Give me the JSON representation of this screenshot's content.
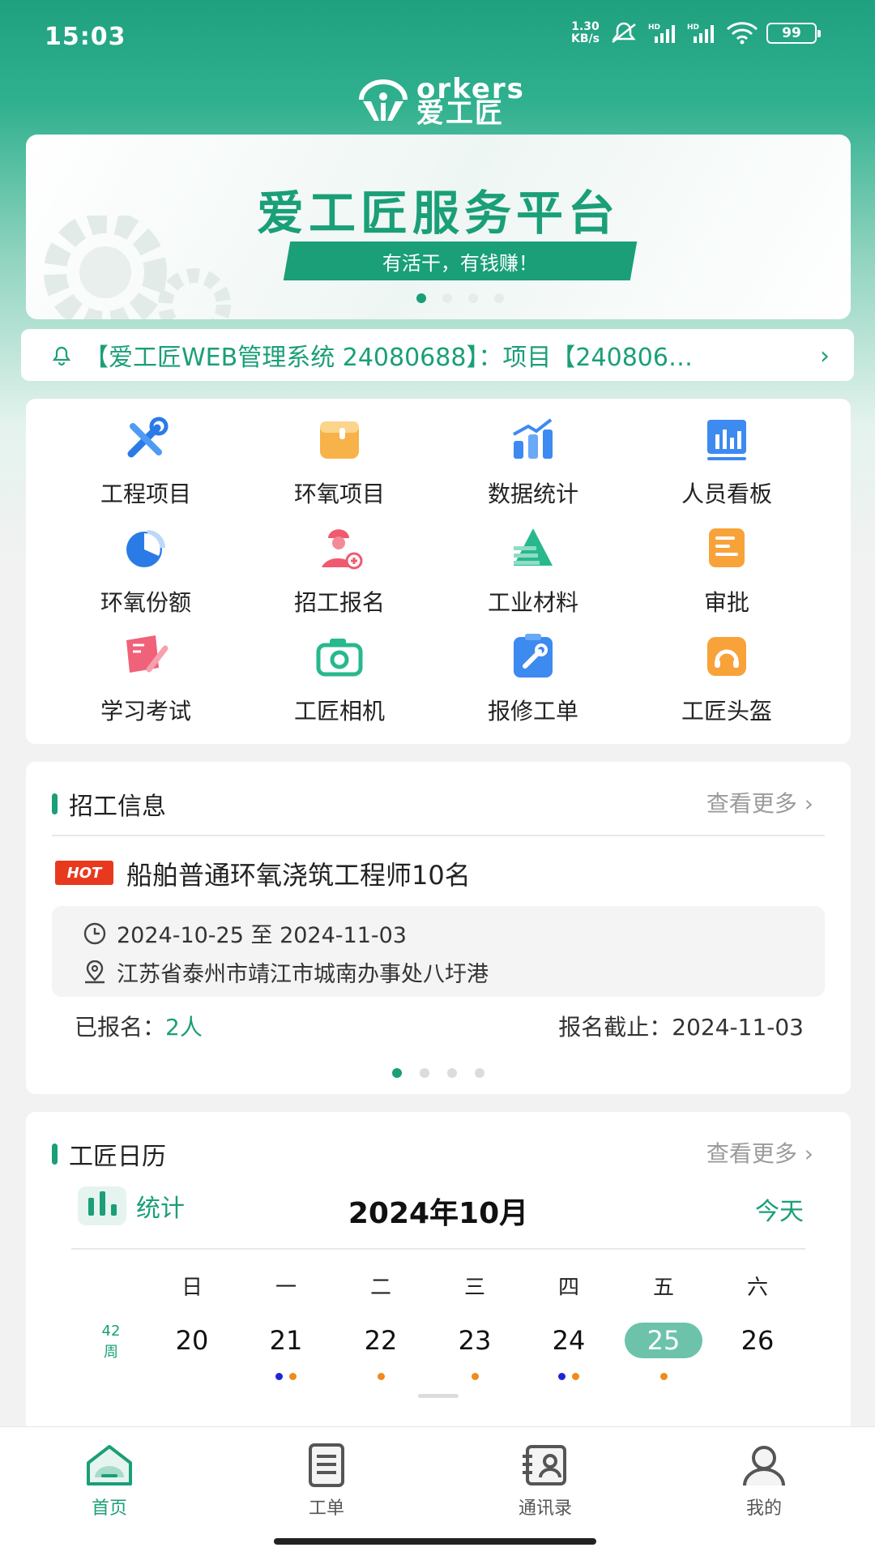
{
  "status_bar": {
    "time": "15:03",
    "net_speed": "1.30",
    "net_unit": "KB/s",
    "battery": "99"
  },
  "logo": {
    "brand_en": "orkers",
    "brand_cn": "爱工匠"
  },
  "banner": {
    "title": "爱工匠服务平台",
    "slogan": "有活干，有钱赚！"
  },
  "notice": {
    "text": "【爱工匠WEB管理系统 24080688】：项目【240806…"
  },
  "grid": [
    {
      "label": "工程项目",
      "icon": "tools-icon"
    },
    {
      "label": "环氧项目",
      "icon": "bucket-icon"
    },
    {
      "label": "数据统计",
      "icon": "bar-chart-icon"
    },
    {
      "label": "人员看板",
      "icon": "board-icon"
    },
    {
      "label": "环氧份额",
      "icon": "pie-chart-icon"
    },
    {
      "label": "招工报名",
      "icon": "worker-add-icon"
    },
    {
      "label": "工业材料",
      "icon": "material-icon"
    },
    {
      "label": "审批",
      "icon": "approval-icon"
    },
    {
      "label": "学习考试",
      "icon": "study-icon"
    },
    {
      "label": "工匠相机",
      "icon": "camera-icon"
    },
    {
      "label": "报修工单",
      "icon": "repair-icon"
    },
    {
      "label": "工匠头盔",
      "icon": "helmet-icon"
    }
  ],
  "recruit": {
    "title": "招工信息",
    "more": "查看更多",
    "badge": "HOT",
    "job_title": "船舶普通环氧浇筑工程师10名",
    "date_range": "2024-10-25 至 2024-11-03",
    "location": "江苏省泰州市靖江市城南办事处八圩港",
    "signed_label": "已报名：",
    "signed_count": "2人",
    "deadline": "报名截止：2024-11-03"
  },
  "calendar": {
    "title": "工匠日历",
    "more": "查看更多",
    "stats_label": "统计",
    "month": "2024年10月",
    "today_label": "今天",
    "weekdays": [
      "日",
      "一",
      "二",
      "三",
      "四",
      "五",
      "六"
    ],
    "week_no": "42",
    "week_unit": "周",
    "days": [
      "20",
      "21",
      "22",
      "23",
      "24",
      "25",
      "26"
    ],
    "selected_day": "25"
  },
  "tabbar": [
    {
      "label": "首页",
      "icon": "home-icon",
      "active": true
    },
    {
      "label": "工单",
      "icon": "order-icon",
      "active": false
    },
    {
      "label": "通讯录",
      "icon": "contacts-icon",
      "active": false
    },
    {
      "label": "我的",
      "icon": "profile-icon",
      "active": false
    }
  ],
  "colors": {
    "accent": "#1a9f78",
    "hot": "#e8391f",
    "marker_blue": "#1c25d8",
    "marker_orange": "#f08a1c"
  }
}
